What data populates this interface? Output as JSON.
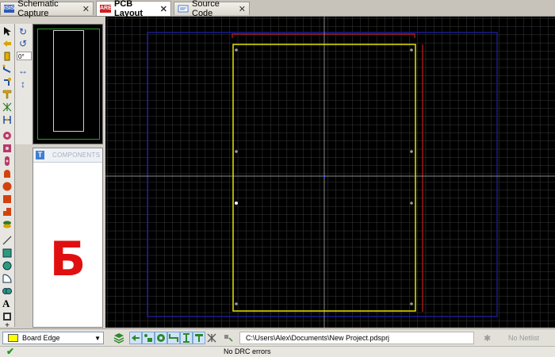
{
  "tabs": [
    {
      "label": "Schematic Capture",
      "icon": "isis-icon",
      "icon_text": "ISIS",
      "icon_color": "#2d58b8",
      "active": false
    },
    {
      "label": "PCB Layout",
      "icon": "ares-icon",
      "icon_text": "ARES",
      "icon_color": "#d02020",
      "active": true
    },
    {
      "label": "Source Code",
      "icon": "source-code-icon",
      "icon_text": "",
      "icon_color": "#4a7bc8",
      "active": false
    }
  ],
  "rotation": {
    "angle": "0°"
  },
  "components_panel": {
    "title": "COMPONENTS",
    "t_button": "T",
    "overlay_letter": "Б"
  },
  "layer": {
    "name": "Board Edge",
    "color": "#ffff00"
  },
  "project_path": "C:\\Users\\Alex\\Documents\\New Project.pdsprj",
  "netlist_status": "No Netlist",
  "drc_status": "No DRC errors",
  "colors": {
    "board_edge": "#ffff00",
    "grid": "#3a3a3a",
    "axis": "#8a8a8a",
    "boundary_blue": "#1a1a8f",
    "boundary_red": "#a01818",
    "canvas_bg": "#000000"
  }
}
